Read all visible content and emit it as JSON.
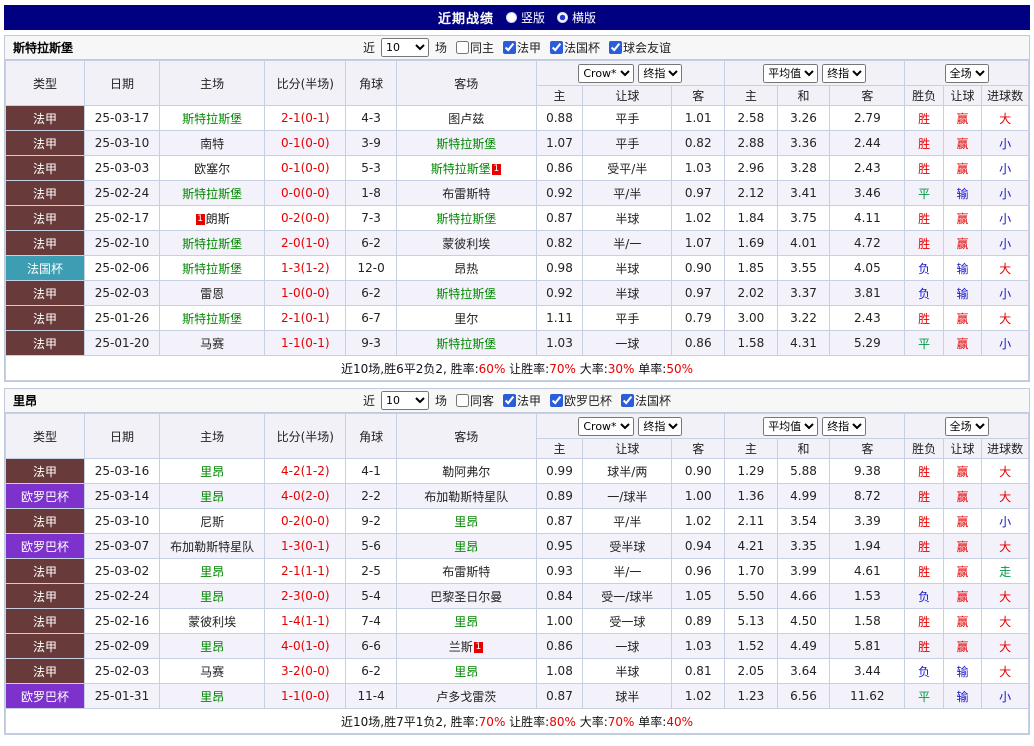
{
  "page": {
    "title": "近期战绩",
    "views": [
      {
        "label": "竖版",
        "selected": false
      },
      {
        "label": "横版",
        "selected": true
      }
    ]
  },
  "colors": {
    "topbar": "#000080",
    "ligue1": "#683a3a",
    "coupe_de_france": "#3d9db3",
    "europa": "#7d32cc",
    "team_green": "#008800",
    "score_red": "#e60000",
    "win_red": "#e60000",
    "lose_blue": "#1616cc",
    "draw_green": "#009944"
  },
  "table_header": {
    "static_cols": [
      "类型",
      "日期",
      "主场",
      "比分(半场)",
      "角球",
      "客场"
    ],
    "groups": [
      {
        "selects": [
          "Crow*",
          "终指"
        ],
        "subs": [
          "主",
          "让球",
          "客"
        ]
      },
      {
        "selects": [
          "平均值",
          "终指"
        ],
        "subs": [
          "主",
          "和",
          "客"
        ]
      },
      {
        "selects": [
          "全场"
        ],
        "subs": [
          "胜负",
          "让球",
          "进球数"
        ]
      }
    ]
  },
  "sections": [
    {
      "team": "斯特拉斯堡",
      "filter": {
        "near": "近",
        "count": "10",
        "unit": "场",
        "checks": [
          {
            "label": "同主",
            "checked": false
          },
          {
            "label": "法甲",
            "checked": true
          },
          {
            "label": "法国杯",
            "checked": true
          },
          {
            "label": "球会友谊",
            "checked": true
          }
        ]
      },
      "rows": [
        {
          "league": {
            "label": "法甲",
            "color": "#683a3a"
          },
          "date": "25-03-17",
          "home": {
            "name": "斯特拉斯堡",
            "green": true
          },
          "score": "2-1(0-1)",
          "corner": "4-3",
          "away": {
            "name": "图卢兹"
          },
          "o1": [
            "0.88",
            "平手",
            "1.01"
          ],
          "o2": [
            "2.58",
            "3.26",
            "2.79"
          ],
          "res": [
            [
              "胜",
              "w"
            ],
            [
              "赢",
              "w"
            ],
            [
              "大",
              "w"
            ]
          ]
        },
        {
          "league": {
            "label": "法甲",
            "color": "#683a3a"
          },
          "date": "25-03-10",
          "home": {
            "name": "南特"
          },
          "score": "0-1(0-0)",
          "corner": "3-9",
          "away": {
            "name": "斯特拉斯堡",
            "green": true
          },
          "o1": [
            "1.07",
            "平手",
            "0.82"
          ],
          "o2": [
            "2.88",
            "3.36",
            "2.44"
          ],
          "res": [
            [
              "胜",
              "w"
            ],
            [
              "赢",
              "w"
            ],
            [
              "小",
              "l"
            ]
          ]
        },
        {
          "league": {
            "label": "法甲",
            "color": "#683a3a"
          },
          "date": "25-03-03",
          "home": {
            "name": "欧塞尔"
          },
          "score": "0-1(0-0)",
          "corner": "5-3",
          "away": {
            "name": "斯特拉斯堡",
            "green": true,
            "redcard": "after"
          },
          "o1": [
            "0.86",
            "受平/半",
            "1.03"
          ],
          "o2": [
            "2.96",
            "3.28",
            "2.43"
          ],
          "res": [
            [
              "胜",
              "w"
            ],
            [
              "赢",
              "w"
            ],
            [
              "小",
              "l"
            ]
          ]
        },
        {
          "league": {
            "label": "法甲",
            "color": "#683a3a"
          },
          "date": "25-02-24",
          "home": {
            "name": "斯特拉斯堡",
            "green": true
          },
          "score": "0-0(0-0)",
          "corner": "1-8",
          "away": {
            "name": "布雷斯特"
          },
          "o1": [
            "0.92",
            "平/半",
            "0.97"
          ],
          "o2": [
            "2.12",
            "3.41",
            "3.46"
          ],
          "res": [
            [
              "平",
              "d"
            ],
            [
              "输",
              "l"
            ],
            [
              "小",
              "l"
            ]
          ]
        },
        {
          "league": {
            "label": "法甲",
            "color": "#683a3a"
          },
          "date": "25-02-17",
          "home": {
            "name": "朗斯",
            "redcard": "before"
          },
          "score": "0-2(0-0)",
          "corner": "7-3",
          "away": {
            "name": "斯特拉斯堡",
            "green": true
          },
          "o1": [
            "0.87",
            "半球",
            "1.02"
          ],
          "o2": [
            "1.84",
            "3.75",
            "4.11"
          ],
          "res": [
            [
              "胜",
              "w"
            ],
            [
              "赢",
              "w"
            ],
            [
              "小",
              "l"
            ]
          ]
        },
        {
          "league": {
            "label": "法甲",
            "color": "#683a3a"
          },
          "date": "25-02-10",
          "home": {
            "name": "斯特拉斯堡",
            "green": true
          },
          "score": "2-0(1-0)",
          "corner": "6-2",
          "away": {
            "name": "蒙彼利埃"
          },
          "o1": [
            "0.82",
            "半/一",
            "1.07"
          ],
          "o2": [
            "1.69",
            "4.01",
            "4.72"
          ],
          "res": [
            [
              "胜",
              "w"
            ],
            [
              "赢",
              "w"
            ],
            [
              "小",
              "l"
            ]
          ]
        },
        {
          "league": {
            "label": "法国杯",
            "color": "#3d9db3"
          },
          "date": "25-02-06",
          "home": {
            "name": "斯特拉斯堡",
            "green": true
          },
          "score": "1-3(1-2)",
          "corner": "12-0",
          "away": {
            "name": "昂热"
          },
          "o1": [
            "0.98",
            "半球",
            "0.90"
          ],
          "o2": [
            "1.85",
            "3.55",
            "4.05"
          ],
          "res": [
            [
              "负",
              "l"
            ],
            [
              "输",
              "l"
            ],
            [
              "大",
              "w"
            ]
          ]
        },
        {
          "league": {
            "label": "法甲",
            "color": "#683a3a"
          },
          "date": "25-02-03",
          "home": {
            "name": "雷恩"
          },
          "score": "1-0(0-0)",
          "corner": "6-2",
          "away": {
            "name": "斯特拉斯堡",
            "green": true
          },
          "o1": [
            "0.92",
            "半球",
            "0.97"
          ],
          "o2": [
            "2.02",
            "3.37",
            "3.81"
          ],
          "res": [
            [
              "负",
              "l"
            ],
            [
              "输",
              "l"
            ],
            [
              "小",
              "l"
            ]
          ]
        },
        {
          "league": {
            "label": "法甲",
            "color": "#683a3a"
          },
          "date": "25-01-26",
          "home": {
            "name": "斯特拉斯堡",
            "green": true
          },
          "score": "2-1(0-1)",
          "corner": "6-7",
          "away": {
            "name": "里尔"
          },
          "o1": [
            "1.11",
            "平手",
            "0.79"
          ],
          "o2": [
            "3.00",
            "3.22",
            "2.43"
          ],
          "res": [
            [
              "胜",
              "w"
            ],
            [
              "赢",
              "w"
            ],
            [
              "大",
              "w"
            ]
          ]
        },
        {
          "league": {
            "label": "法甲",
            "color": "#683a3a"
          },
          "date": "25-01-20",
          "home": {
            "name": "马赛"
          },
          "score": "1-1(0-1)",
          "corner": "9-3",
          "away": {
            "name": "斯特拉斯堡",
            "green": true
          },
          "o1": [
            "1.03",
            "一球",
            "0.86"
          ],
          "o2": [
            "1.58",
            "4.31",
            "5.29"
          ],
          "res": [
            [
              "平",
              "d"
            ],
            [
              "赢",
              "w"
            ],
            [
              "小",
              "l"
            ]
          ]
        }
      ],
      "summary": {
        "prefix": "近10场,胜6平2负2,",
        "stats": [
          {
            "label": "胜率:",
            "value": "60%"
          },
          {
            "label": "让胜率:",
            "value": "70%"
          },
          {
            "label": "大率:",
            "value": "30%"
          },
          {
            "label": "单率:",
            "value": "50%"
          }
        ]
      }
    },
    {
      "team": "里昂",
      "filter": {
        "near": "近",
        "count": "10",
        "unit": "场",
        "checks": [
          {
            "label": "同客",
            "checked": false
          },
          {
            "label": "法甲",
            "checked": true
          },
          {
            "label": "欧罗巴杯",
            "checked": true
          },
          {
            "label": "法国杯",
            "checked": true
          }
        ]
      },
      "rows": [
        {
          "league": {
            "label": "法甲",
            "color": "#683a3a"
          },
          "date": "25-03-16",
          "home": {
            "name": "里昂",
            "green": true
          },
          "score": "4-2(1-2)",
          "corner": "4-1",
          "away": {
            "name": "勒阿弗尔"
          },
          "o1": [
            "0.99",
            "球半/两",
            "0.90"
          ],
          "o2": [
            "1.29",
            "5.88",
            "9.38"
          ],
          "res": [
            [
              "胜",
              "w"
            ],
            [
              "赢",
              "w"
            ],
            [
              "大",
              "w"
            ]
          ]
        },
        {
          "league": {
            "label": "欧罗巴杯",
            "color": "#7d32cc"
          },
          "date": "25-03-14",
          "home": {
            "name": "里昂",
            "green": true
          },
          "score": "4-0(2-0)",
          "corner": "2-2",
          "away": {
            "name": "布加勒斯特星队"
          },
          "o1": [
            "0.89",
            "一/球半",
            "1.00"
          ],
          "o2": [
            "1.36",
            "4.99",
            "8.72"
          ],
          "res": [
            [
              "胜",
              "w"
            ],
            [
              "赢",
              "w"
            ],
            [
              "大",
              "w"
            ]
          ]
        },
        {
          "league": {
            "label": "法甲",
            "color": "#683a3a"
          },
          "date": "25-03-10",
          "home": {
            "name": "尼斯"
          },
          "score": "0-2(0-0)",
          "corner": "9-2",
          "away": {
            "name": "里昂",
            "green": true
          },
          "o1": [
            "0.87",
            "平/半",
            "1.02"
          ],
          "o2": [
            "2.11",
            "3.54",
            "3.39"
          ],
          "res": [
            [
              "胜",
              "w"
            ],
            [
              "赢",
              "w"
            ],
            [
              "小",
              "l"
            ]
          ]
        },
        {
          "league": {
            "label": "欧罗巴杯",
            "color": "#7d32cc"
          },
          "date": "25-03-07",
          "home": {
            "name": "布加勒斯特星队"
          },
          "score": "1-3(0-1)",
          "corner": "5-6",
          "away": {
            "name": "里昂",
            "green": true
          },
          "o1": [
            "0.95",
            "受半球",
            "0.94"
          ],
          "o2": [
            "4.21",
            "3.35",
            "1.94"
          ],
          "res": [
            [
              "胜",
              "w"
            ],
            [
              "赢",
              "w"
            ],
            [
              "大",
              "w"
            ]
          ]
        },
        {
          "league": {
            "label": "法甲",
            "color": "#683a3a"
          },
          "date": "25-03-02",
          "home": {
            "name": "里昂",
            "green": true
          },
          "score": "2-1(1-1)",
          "corner": "2-5",
          "away": {
            "name": "布雷斯特"
          },
          "o1": [
            "0.93",
            "半/一",
            "0.96"
          ],
          "o2": [
            "1.70",
            "3.99",
            "4.61"
          ],
          "res": [
            [
              "胜",
              "w"
            ],
            [
              "赢",
              "w"
            ],
            [
              "走",
              "d"
            ]
          ]
        },
        {
          "league": {
            "label": "法甲",
            "color": "#683a3a"
          },
          "date": "25-02-24",
          "home": {
            "name": "里昂",
            "green": true
          },
          "score": "2-3(0-0)",
          "corner": "5-4",
          "away": {
            "name": "巴黎圣日尔曼"
          },
          "o1": [
            "0.84",
            "受一/球半",
            "1.05"
          ],
          "o2": [
            "5.50",
            "4.66",
            "1.53"
          ],
          "res": [
            [
              "负",
              "l"
            ],
            [
              "赢",
              "w"
            ],
            [
              "大",
              "w"
            ]
          ]
        },
        {
          "league": {
            "label": "法甲",
            "color": "#683a3a"
          },
          "date": "25-02-16",
          "home": {
            "name": "蒙彼利埃"
          },
          "score": "1-4(1-1)",
          "corner": "7-4",
          "away": {
            "name": "里昂",
            "green": true
          },
          "o1": [
            "1.00",
            "受一球",
            "0.89"
          ],
          "o2": [
            "5.13",
            "4.50",
            "1.58"
          ],
          "res": [
            [
              "胜",
              "w"
            ],
            [
              "赢",
              "w"
            ],
            [
              "大",
              "w"
            ]
          ]
        },
        {
          "league": {
            "label": "法甲",
            "color": "#683a3a"
          },
          "date": "25-02-09",
          "home": {
            "name": "里昂",
            "green": true
          },
          "score": "4-0(1-0)",
          "corner": "6-6",
          "away": {
            "name": "兰斯",
            "redcard": "after"
          },
          "o1": [
            "0.86",
            "一球",
            "1.03"
          ],
          "o2": [
            "1.52",
            "4.49",
            "5.81"
          ],
          "res": [
            [
              "胜",
              "w"
            ],
            [
              "赢",
              "w"
            ],
            [
              "大",
              "w"
            ]
          ]
        },
        {
          "league": {
            "label": "法甲",
            "color": "#683a3a"
          },
          "date": "25-02-03",
          "home": {
            "name": "马赛"
          },
          "score": "3-2(0-0)",
          "corner": "6-2",
          "away": {
            "name": "里昂",
            "green": true
          },
          "o1": [
            "1.08",
            "半球",
            "0.81"
          ],
          "o2": [
            "2.05",
            "3.64",
            "3.44"
          ],
          "res": [
            [
              "负",
              "l"
            ],
            [
              "输",
              "l"
            ],
            [
              "大",
              "w"
            ]
          ]
        },
        {
          "league": {
            "label": "欧罗巴杯",
            "color": "#7d32cc"
          },
          "date": "25-01-31",
          "home": {
            "name": "里昂",
            "green": true
          },
          "score": "1-1(0-0)",
          "corner": "11-4",
          "away": {
            "name": "卢多戈雷茨"
          },
          "o1": [
            "0.87",
            "球半",
            "1.02"
          ],
          "o2": [
            "1.23",
            "6.56",
            "11.62"
          ],
          "res": [
            [
              "平",
              "d"
            ],
            [
              "输",
              "l"
            ],
            [
              "小",
              "l"
            ]
          ]
        }
      ],
      "summary": {
        "prefix": "近10场,胜7平1负2,",
        "stats": [
          {
            "label": "胜率:",
            "value": "70%"
          },
          {
            "label": "让胜率:",
            "value": "80%"
          },
          {
            "label": "大率:",
            "value": "70%"
          },
          {
            "label": "单率:",
            "value": "40%"
          }
        ]
      }
    }
  ]
}
